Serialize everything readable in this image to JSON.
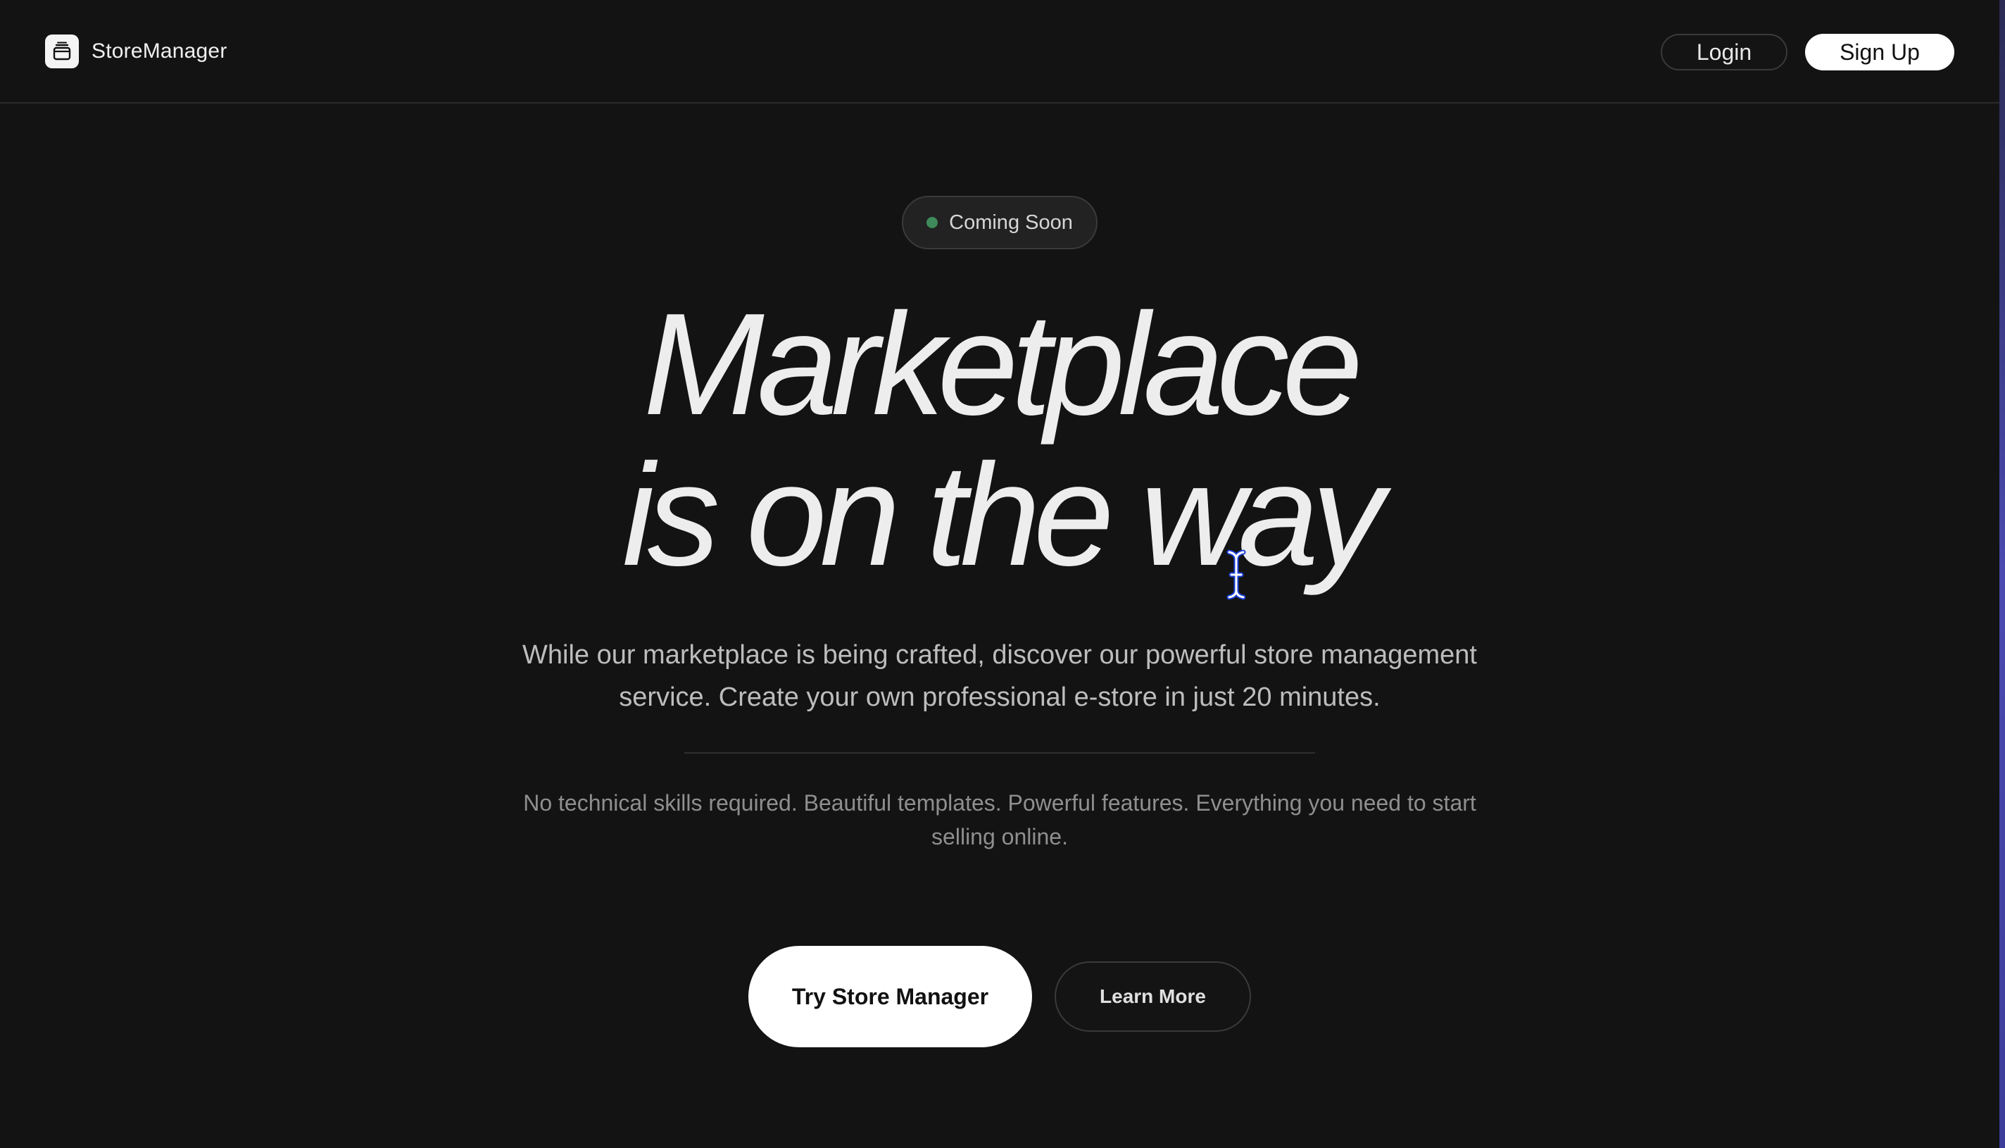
{
  "header": {
    "brand_name": "StoreManager",
    "brand_icon": "store-box-icon",
    "login_label": "Login",
    "signup_label": "Sign Up"
  },
  "hero": {
    "badge_label": "Coming Soon",
    "badge_dot_color": "#3f8a5a",
    "headline_line1": "Marketplace",
    "headline_line2": "is on the way",
    "subtext": "While our marketplace is being crafted, discover our powerful store management service. Create your own professional e-store in just 20 minutes.",
    "small_text": "No technical skills required. Beautiful templates. Powerful features. Everything you need to start selling online.",
    "primary_cta": "Try Store Manager",
    "secondary_cta": "Learn More"
  },
  "colors": {
    "background": "#131313",
    "primary_button": "#ffffff",
    "text": "#ededed"
  }
}
